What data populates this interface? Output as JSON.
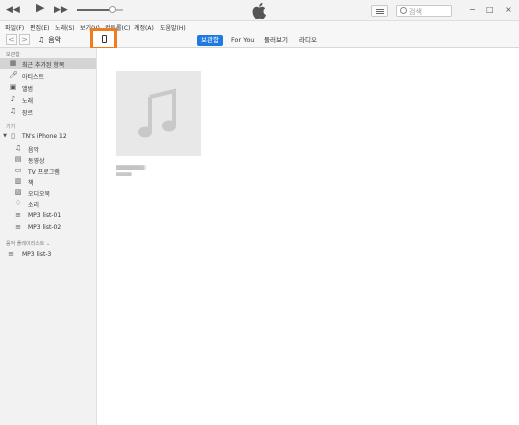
{
  "player": {
    "rewind_icon": "rewind-icon",
    "play_icon": "play-icon",
    "forward_icon": "fast-forward-icon",
    "volume_level": 0.78
  },
  "search": {
    "placeholder": "검색"
  },
  "window_controls": {
    "minimize": "−",
    "maximize": "□",
    "close": "×"
  },
  "menu": [
    "파일(F)",
    "편집(E)",
    "노래(S)",
    "보기(V)",
    "컨트롤(C)",
    "계정(A)",
    "도움말(H)"
  ],
  "nav": {
    "back": "<",
    "forward": ">",
    "media_type": "음악",
    "tabs": [
      "보관함",
      "For You",
      "둘러보기",
      "라디오"
    ],
    "active_tab": "보관함"
  },
  "sidebar": {
    "library_header": "보관함",
    "library": [
      {
        "label": "최근 추가된 항목",
        "icon": "grid-icon",
        "selected": true
      },
      {
        "label": "아티스트",
        "icon": "microphone-icon"
      },
      {
        "label": "앨범",
        "icon": "album-icon"
      },
      {
        "label": "노래",
        "icon": "music-note-icon"
      },
      {
        "label": "장르",
        "icon": "genre-icon"
      }
    ],
    "devices_header": "기기",
    "device_name": "TN's iPhone 12",
    "device_items": [
      {
        "label": "음악",
        "icon": "music-note-icon"
      },
      {
        "label": "동영상",
        "icon": "film-icon"
      },
      {
        "label": "TV 프로그램",
        "icon": "tv-icon"
      },
      {
        "label": "책",
        "icon": "book-icon"
      },
      {
        "label": "오디오북",
        "icon": "audiobook-icon"
      },
      {
        "label": "소리",
        "icon": "bell-icon"
      },
      {
        "label": "MP3 list-01",
        "icon": "playlist-icon"
      },
      {
        "label": "MP3 list-02",
        "icon": "playlist-icon"
      }
    ],
    "playlists_header": "음악 플레이리스트 ⌄",
    "playlists": [
      {
        "label": "MP3 list-3",
        "icon": "playlist-icon"
      }
    ]
  },
  "content": {
    "album": {
      "title": "▒▒▒▒▒▒▒▒▒",
      "artist": "▒▒▒▒▒"
    }
  },
  "colors": {
    "accent": "#1f7ae0",
    "highlight_box": "#ee7d22"
  }
}
